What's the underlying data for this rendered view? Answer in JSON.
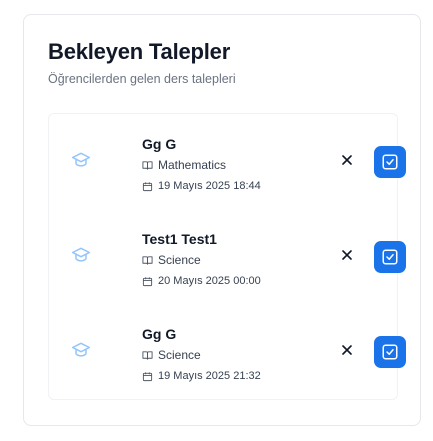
{
  "header": {
    "title": "Bekleyen Talepler",
    "subtitle": "Öğrencilerden gelen ders talepleri"
  },
  "colors": {
    "accent": "#1a73e8",
    "avatar_icon": "#93c5fd",
    "muted_text": "#6b7280"
  },
  "requests": [
    {
      "name": "Gg G",
      "subject": "Mathematics",
      "date": "19 Mayıs 2025 18:44",
      "avatar_icon": "graduation-cap-icon"
    },
    {
      "name": "Test1 Test1",
      "subject": "Science",
      "date": "20 Mayıs 2025 00:00",
      "avatar_icon": "graduation-cap-icon"
    },
    {
      "name": "Gg G",
      "subject": "Science",
      "date": "19 Mayıs 2025 21:32",
      "avatar_icon": "graduation-cap-icon"
    }
  ]
}
